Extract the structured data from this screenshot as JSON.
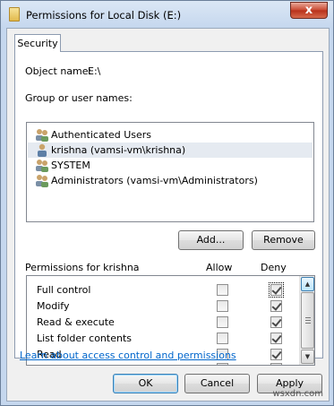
{
  "window": {
    "title": "Permissions for Local Disk (E:)",
    "close_label": "x",
    "tab_label": "Security"
  },
  "object": {
    "label": "Object name:",
    "value": "E:\\"
  },
  "groups": {
    "label": "Group or user names:",
    "items": [
      {
        "name": "Authenticated Users",
        "icon": "users-group-icon",
        "selected": false
      },
      {
        "name": "krishna (vamsi-vm\\krishna)",
        "icon": "user-icon",
        "selected": true
      },
      {
        "name": "SYSTEM",
        "icon": "users-group-icon",
        "selected": false
      },
      {
        "name": "Administrators (vamsi-vm\\Administrators)",
        "icon": "users-group-icon",
        "selected": false
      }
    ]
  },
  "buttons": {
    "add": "Add...",
    "remove": "Remove",
    "ok": "OK",
    "cancel": "Cancel",
    "apply": "Apply"
  },
  "permissions": {
    "label": "Permissions for krishna",
    "allow_header": "Allow",
    "deny_header": "Deny",
    "rows": [
      {
        "name": "Full control",
        "allow": false,
        "deny": true
      },
      {
        "name": "Modify",
        "allow": false,
        "deny": true
      },
      {
        "name": "Read & execute",
        "allow": false,
        "deny": true
      },
      {
        "name": "List folder contents",
        "allow": false,
        "deny": true
      },
      {
        "name": "Read",
        "allow": false,
        "deny": true
      }
    ]
  },
  "link_text": "Learn about access control and permissions",
  "watermark": "wsxdn.com",
  "colors": {
    "link": "#0066cc",
    "close_button": "#c8462f",
    "selection": "#e5eaf1"
  }
}
